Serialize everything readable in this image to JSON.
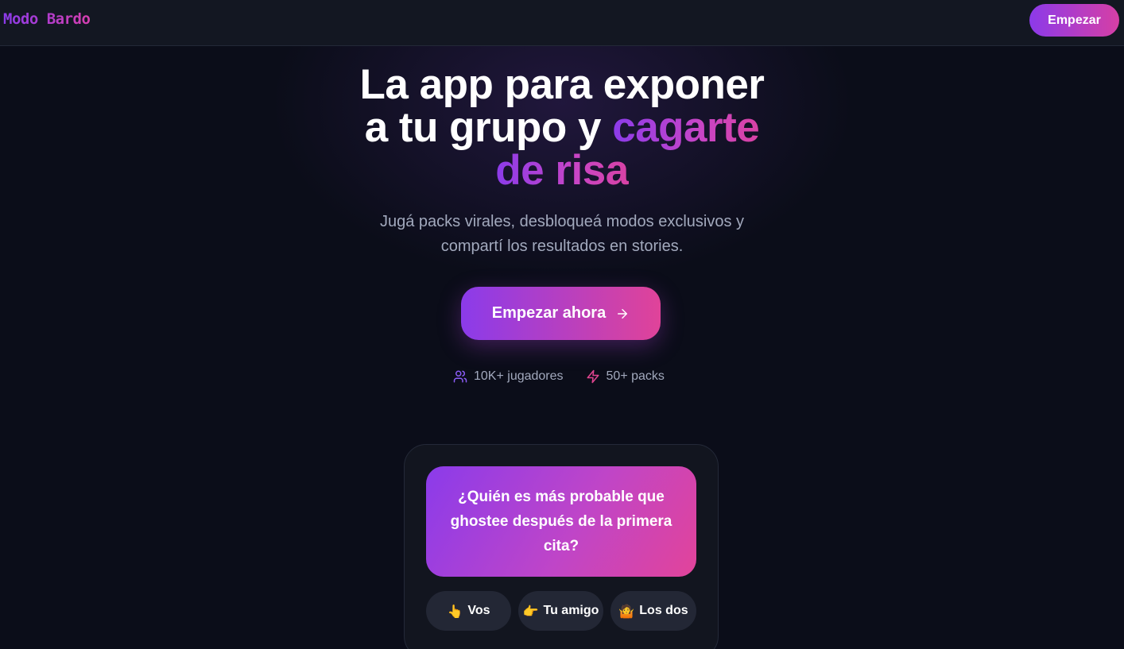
{
  "header": {
    "brand": "Modo Bardo",
    "cta_label": "Empezar"
  },
  "hero": {
    "title_line1": "La app para exponer",
    "title_line2_plain": "a tu grupo y ",
    "title_line2_accent": "cagarte",
    "title_line3_accent": "de risa",
    "subtitle_line1": "Jugá packs virales, desbloqueá modos exclusivos y",
    "subtitle_line2": "compartí los resultados en stories.",
    "cta_label": "Empezar ahora",
    "cta_icon": "arrow-right-icon"
  },
  "stats": [
    {
      "icon": "users-icon",
      "label": "10K+ jugadores"
    },
    {
      "icon": "lightning-icon",
      "label": "50+ packs"
    }
  ],
  "preview": {
    "question": "¿Quién es más probable que ghostee después de la primera cita?",
    "options": [
      {
        "emoji": "👆",
        "label": "Vos"
      },
      {
        "emoji": "👉",
        "label": "Tu amigo"
      },
      {
        "emoji": "🤷",
        "label": "Los dos"
      }
    ]
  },
  "colors": {
    "background": "#0b0d19",
    "accent_start": "#8b3bea",
    "accent_end": "#e04399",
    "muted_text": "#a2a9bd"
  }
}
